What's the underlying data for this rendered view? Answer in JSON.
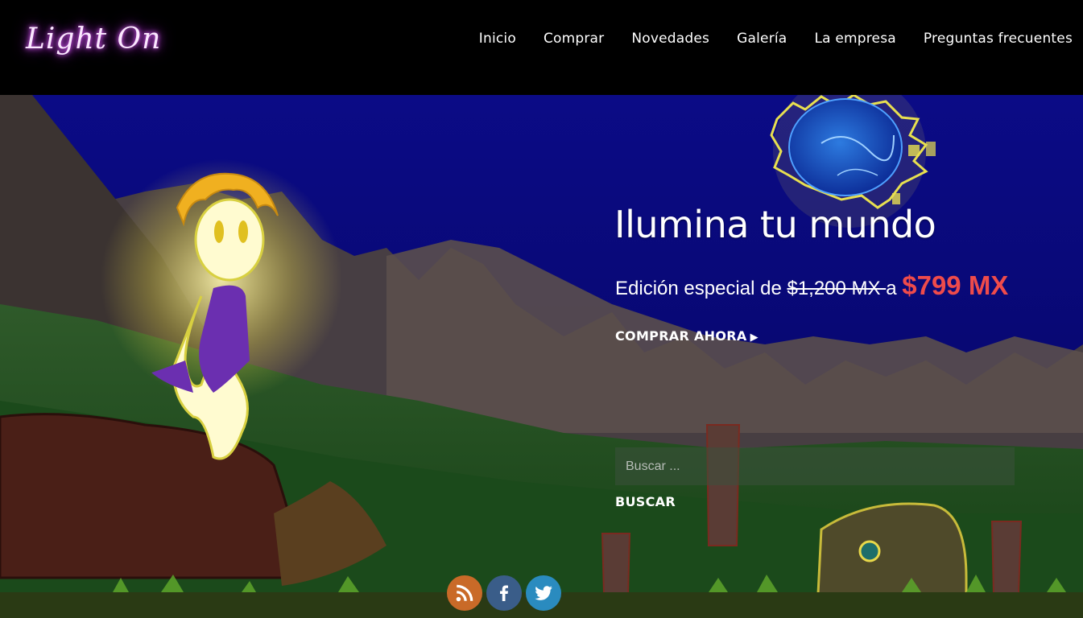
{
  "header": {
    "logo_text": "Light On",
    "nav": [
      {
        "label": "Inicio"
      },
      {
        "label": "Comprar"
      },
      {
        "label": "Novedades"
      },
      {
        "label": "Galería"
      },
      {
        "label": "La empresa"
      },
      {
        "label": "Preguntas frecuentes"
      }
    ]
  },
  "hero": {
    "title": "Ilumina tu mundo",
    "price_prefix": "Edición especial de ",
    "price_old": "$1,200 MX ",
    "price_connector": "a ",
    "price_new": "$799 MX",
    "cta_label": "COMPRAR AHORA"
  },
  "search": {
    "placeholder": "Buscar ...",
    "button_label": "BUSCAR"
  },
  "social": {
    "icons": [
      "rss-icon",
      "facebook-icon",
      "twitter-icon"
    ]
  },
  "colors": {
    "sky": "#0a0a7a",
    "price_highlight": "#ef4b4b",
    "logo_glow": "#e35bff",
    "rss": "#c96a28",
    "facebook": "#3a5d89",
    "twitter": "#2a8bbf"
  }
}
